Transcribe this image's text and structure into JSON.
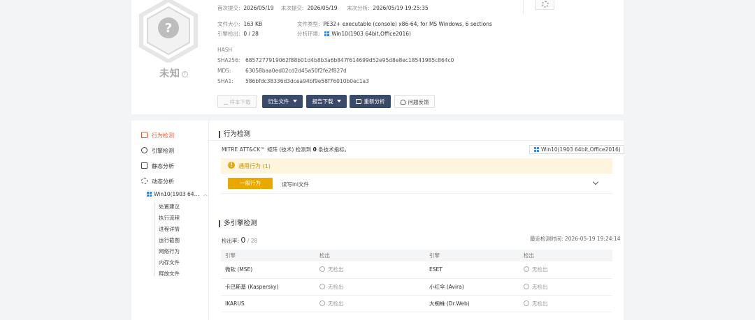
{
  "summary": {
    "verdict": "未知",
    "first_submit_label": "首次提交:",
    "first_submit": "2026/05/19",
    "last_submit_label": "末次提交:",
    "last_submit": "2026/05/19",
    "last_analysis_label": "末次分析:",
    "last_analysis": "2026/05/19 19:25:35",
    "file_size_label": "文件大小:",
    "file_size": "163 KB",
    "file_type_label": "文件类型:",
    "file_type": "PE32+ executable (console) x86-64, for MS Windows, 6 sections",
    "engine_detect_label": "引擎检出:",
    "engine_detect": "0 / 28",
    "analysis_env_label": "分析环境:",
    "analysis_env": "Win10(1903 64bit,Office2016)"
  },
  "hash": {
    "title": "HASH",
    "rows": [
      {
        "label": "SHA256:",
        "value": "6857277919062f88b01d4b8b3a6b847f614699d52e95d8e8ec18541985c864c0"
      },
      {
        "label": "MD5:",
        "value": "63058baa0ed02cd2d45a50f2fe2f827d"
      },
      {
        "label": "SHA1:",
        "value": "586bfdc38336d3dcea94bf9e58f76010b0ec1a3"
      }
    ]
  },
  "actions": {
    "sample_download": "样本下载",
    "derived_files": "衍生文件",
    "report_download": "报告下载",
    "reanalyze": "重新分析",
    "feedback": "问题反馈"
  },
  "sidebar": {
    "items": [
      {
        "label": "行为检测"
      },
      {
        "label": "引擎检测"
      },
      {
        "label": "静态分析"
      },
      {
        "label": "动态分析"
      }
    ],
    "env": "Win10(1903 64...",
    "sub_items": [
      "处置建议",
      "执行流程",
      "进程详情",
      "运行截图",
      "网络行为",
      "内存文件",
      "释放文件"
    ]
  },
  "behavior": {
    "title": "行为检测",
    "mitre_prefix": "MITRE ATT&CK™ 矩阵 (技术) 检测到 ",
    "mitre_count": "0",
    "mitre_suffix": " 条技术指标。",
    "env_tag": "Win10(1903 64bit,Office2016)",
    "warning": "通用行为 (1)",
    "level_button": "一般行为",
    "behavior_desc": "读写ini文件"
  },
  "engines": {
    "title": "多引擎检测",
    "rate_label": "检出率:",
    "rate_value": "0",
    "rate_total": " / 28",
    "last_label": "最近检测时间:",
    "last_time": "2026-05-19 19:24:14",
    "headers": [
      "引擎",
      "检出",
      "引擎",
      "检出"
    ],
    "rows": [
      [
        "微软 (MSE)",
        "无检出",
        "ESET",
        "无检出"
      ],
      [
        "卡巴斯基 (Kaspersky)",
        "无检出",
        "小红伞 (Avira)",
        "无检出"
      ],
      [
        "IKARUS",
        "无检出",
        "大蜘蛛 (Dr.Web)",
        "无检出"
      ]
    ]
  },
  "colors": {
    "accent": "#e05a2b",
    "dark_button": "#3a4a6b",
    "warning": "#e8a800"
  }
}
